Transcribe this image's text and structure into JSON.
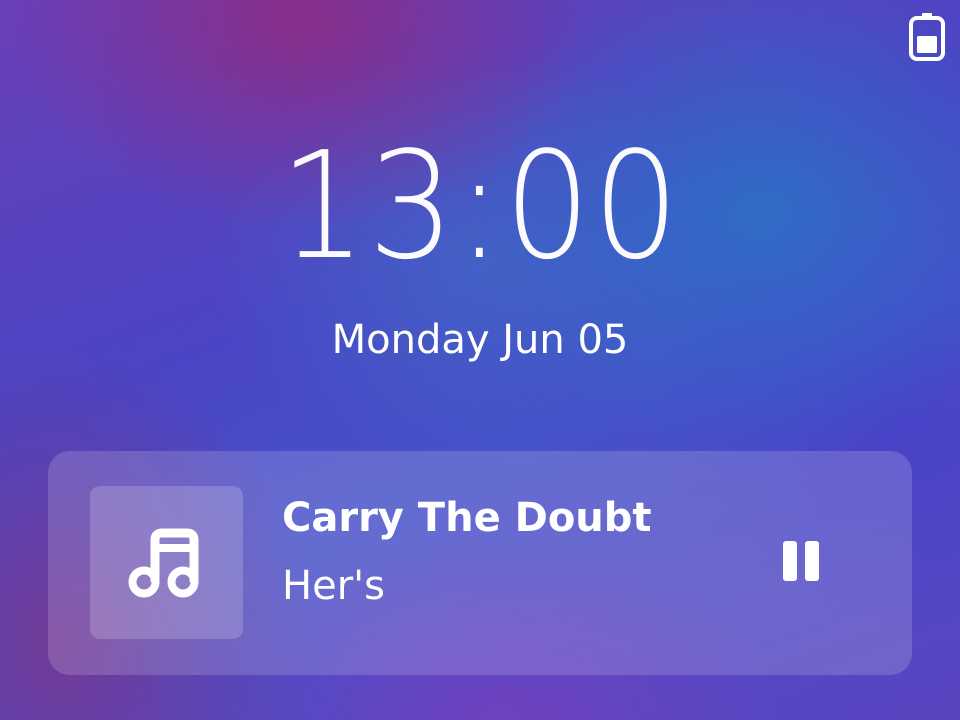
{
  "status_bar": {
    "battery_icon": "battery-icon"
  },
  "lock_screen": {
    "time": "13:00",
    "date": "Monday Jun 05"
  },
  "media_player": {
    "album_art_icon": "music-note-icon",
    "title": "Carry The Doubt",
    "artist": "Her's",
    "control_icon": "pause-icon"
  },
  "colors": {
    "text": "#ffffff",
    "card_background": "rgba(255,255,255,0.16)"
  }
}
